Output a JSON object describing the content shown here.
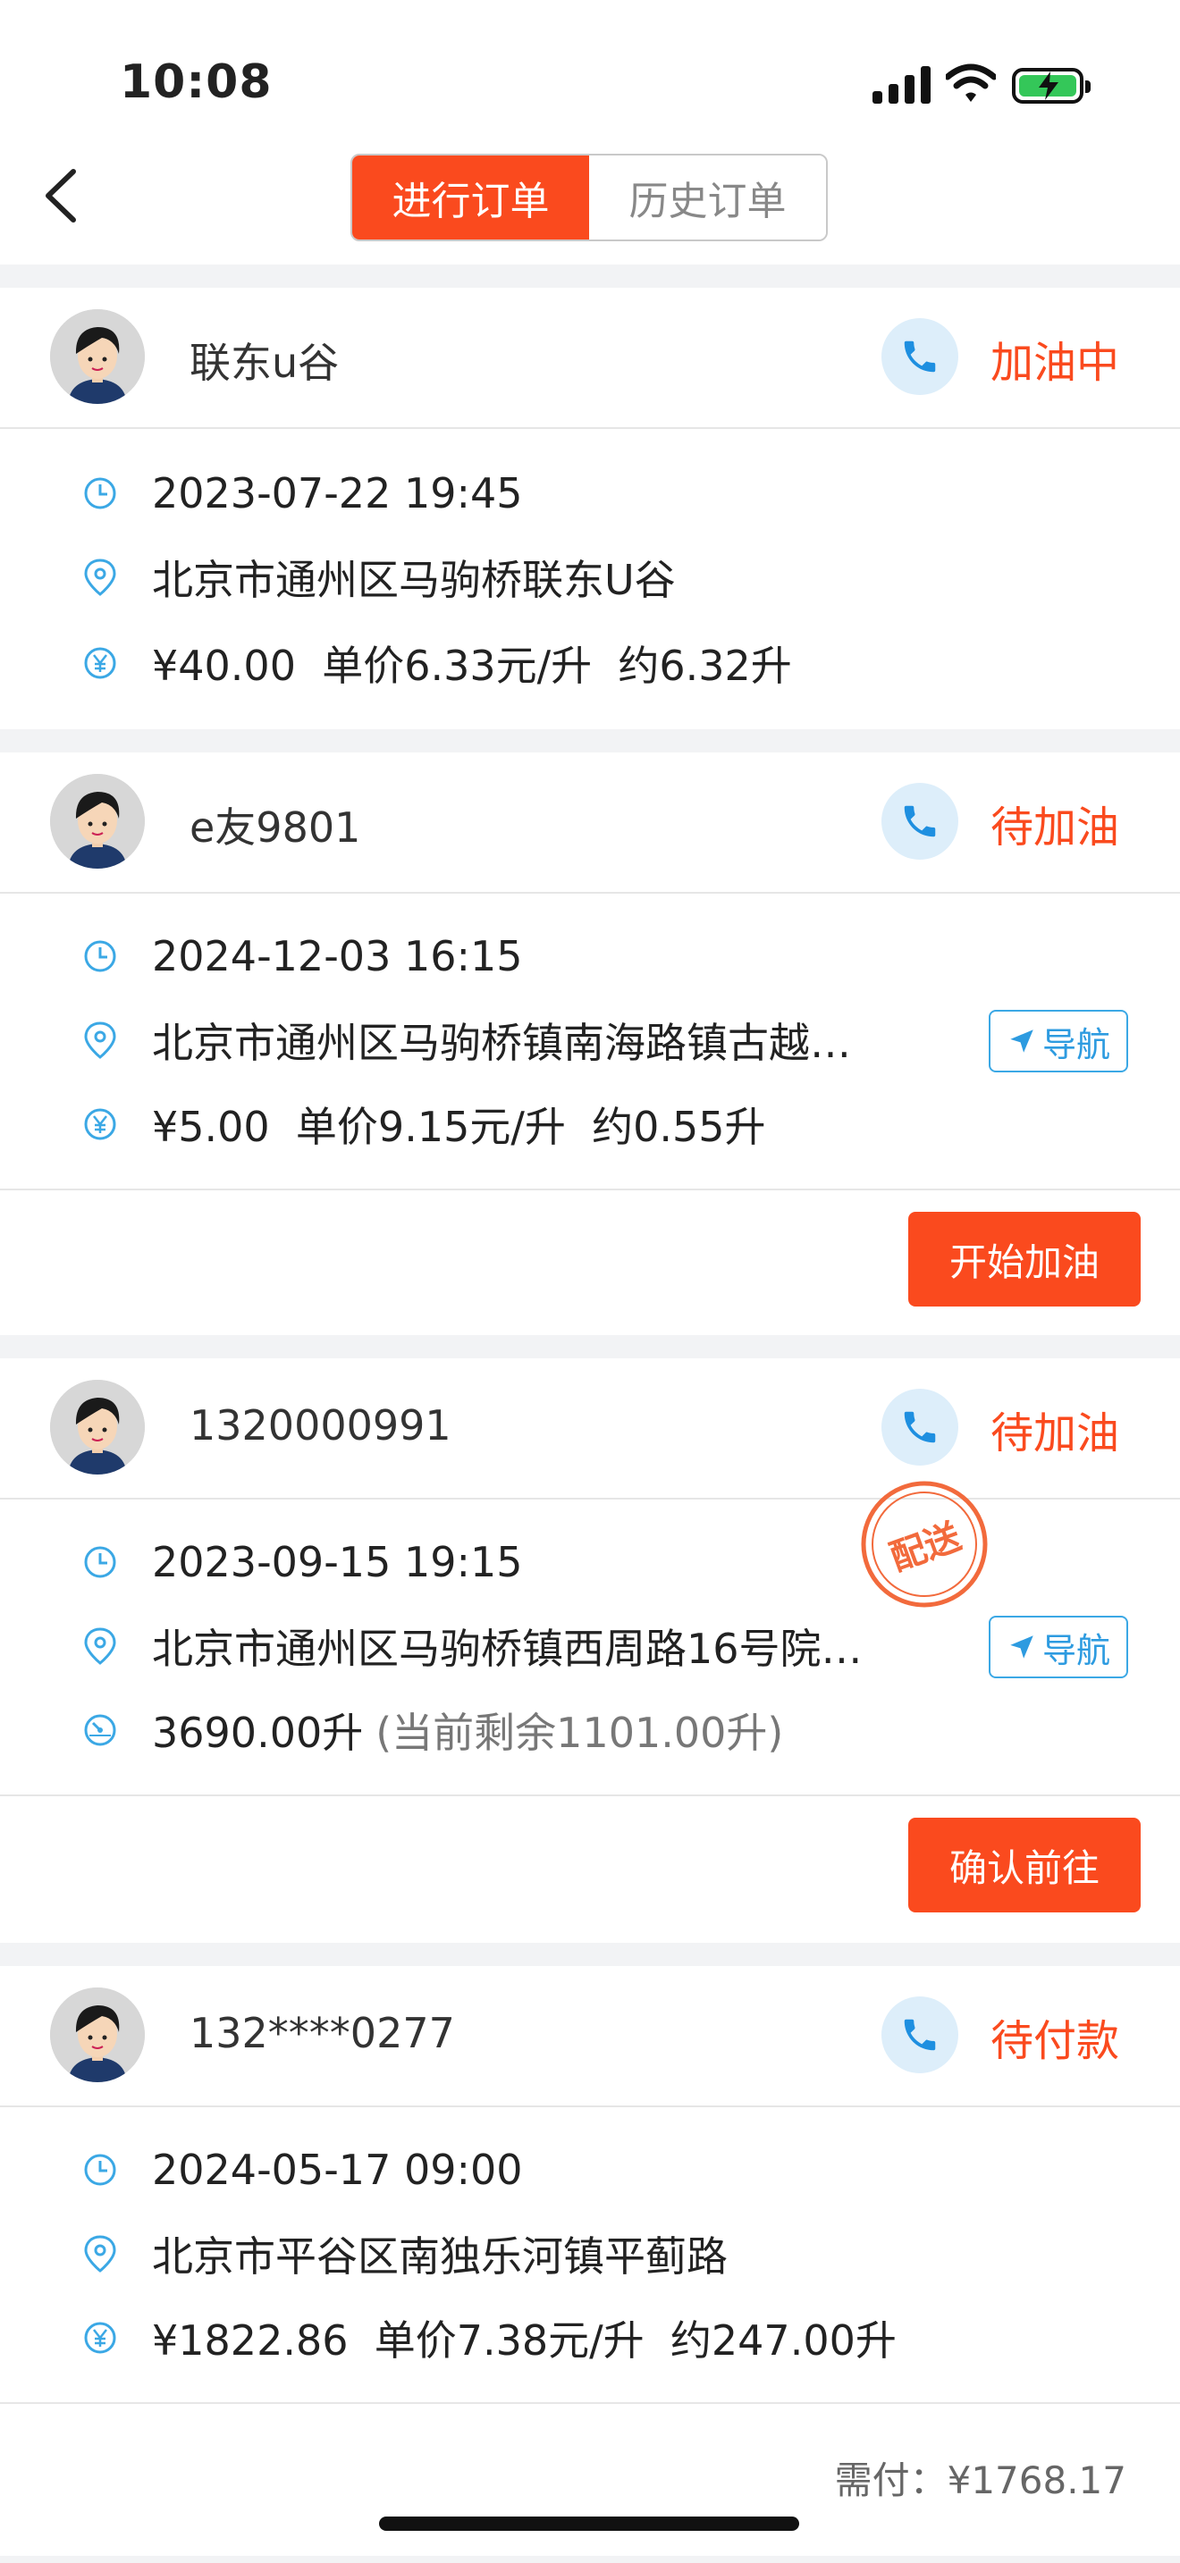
{
  "status_bar": {
    "time": "10:08"
  },
  "tabs": [
    {
      "label": "进行订单",
      "active": true
    },
    {
      "label": "历史订单",
      "active": false
    }
  ],
  "colors": {
    "accent": "#fa4a1e",
    "info_blue": "#2d9be0",
    "phone_bg": "#ddeefa"
  },
  "orders": [
    {
      "name": "联东u谷",
      "status": "加油中",
      "datetime": "2023-07-22 19:45",
      "address": "北京市通州区马驹桥联东U谷",
      "price_line": "¥40.00  单价6.33元/升  约6.32升"
    },
    {
      "name": "e友9801",
      "status": "待加油",
      "datetime": "2024-12-03 16:15",
      "address": "北京市通州区马驹桥镇南海路镇古越…",
      "nav_label": "导航",
      "price_line": "¥5.00  单价9.15元/升  约0.55升",
      "action_label": "开始加油"
    },
    {
      "name": "1320000991",
      "status": "待加油",
      "stamp": "配送",
      "datetime": "2023-09-15 19:15",
      "address": "北京市通州区马驹桥镇西周路16号院…",
      "nav_label": "导航",
      "volume": "3690.00升",
      "remaining": "(当前剩余1101.00升)",
      "action_label": "确认前往"
    },
    {
      "name": "132****0277",
      "status": "待付款",
      "datetime": "2024-05-17 09:00",
      "address": "北京市平谷区南独乐河镇平蓟路",
      "price_line": "¥1822.86  单价7.38元/升  约247.00升",
      "payment_label": "需付：",
      "payment_amount": "¥1768.17"
    }
  ]
}
